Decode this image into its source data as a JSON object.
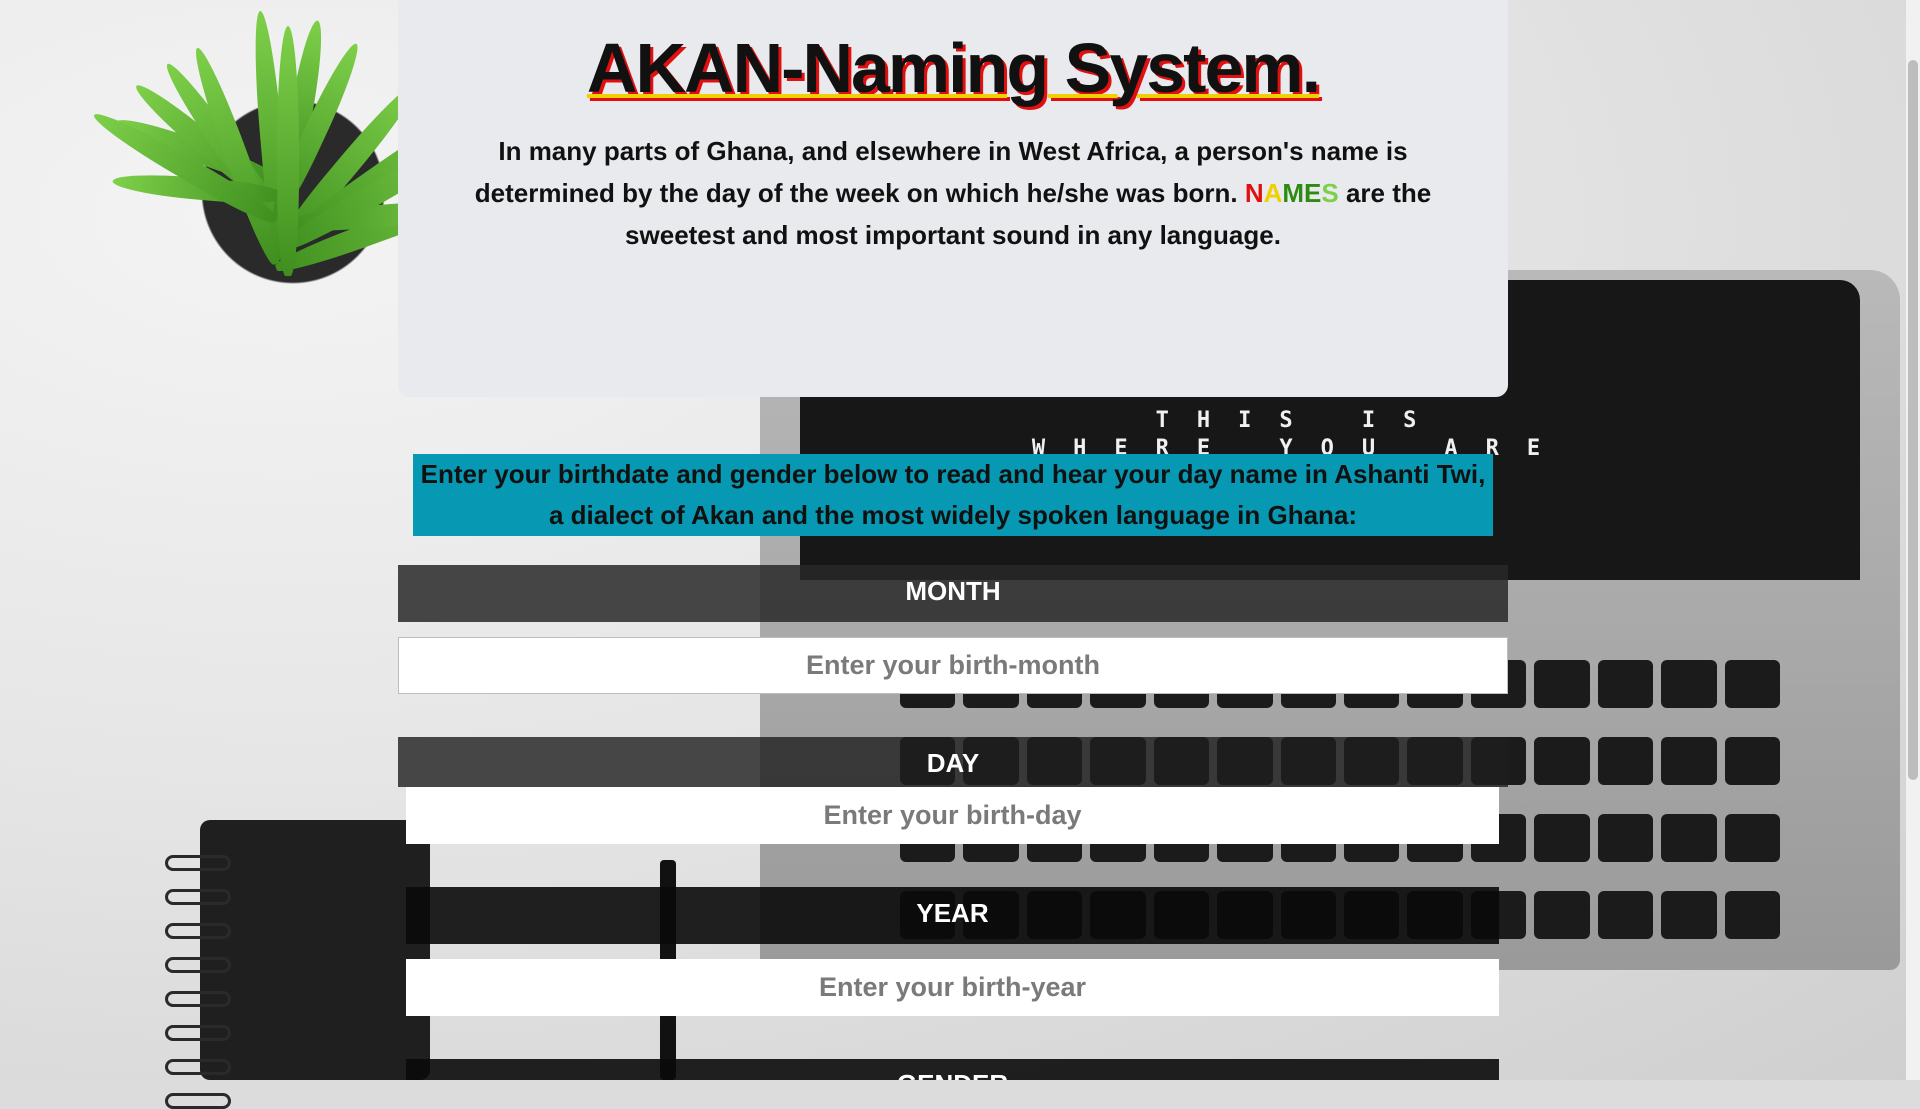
{
  "header": {
    "title": "AKAN-Naming System.",
    "intro_part1": "In many parts of Ghana, and elsewhere in West Africa, a person's name is determined by the day of the week on which he/she was born.",
    "names_letters": [
      "N",
      "A",
      "M",
      "E",
      "S"
    ],
    "names_colors": [
      "#e01010",
      "#f0d000",
      "#2e8b12",
      "#2e8b12",
      "#7ed04a"
    ],
    "intro_part2": "are the sweetest and most important sound in any language."
  },
  "background": {
    "slogan_line1": "THIS IS",
    "slogan_line2": "WHERE YOU ARE"
  },
  "prompt": "Enter your birthdate and gender below to read and hear your day name in Ashanti Twi, a dialect of Akan and the most widely spoken language in Ghana:",
  "form": {
    "month_label": "MONTH",
    "month_placeholder": "Enter your birth-month",
    "day_label": "DAY",
    "day_placeholder": "Enter your birth-day",
    "year_label": "YEAR",
    "year_placeholder": "Enter your birth-year",
    "gender_label": "GENDER"
  },
  "colors": {
    "prompt_bg": "#0799b3",
    "card_bg": "#e9eaed",
    "title_shadow": "#e01010",
    "title_underline": "#f0d000"
  }
}
